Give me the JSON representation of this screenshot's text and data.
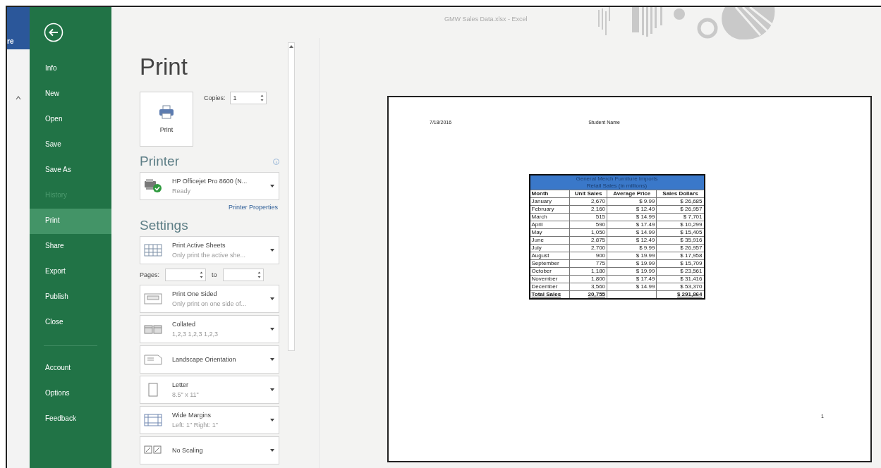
{
  "window": {
    "title": "GMW Sales Data.xlsx - Excel"
  },
  "background_ribbon": {
    "tab_label": "re"
  },
  "backstage_menu": {
    "items": [
      {
        "label": "Info",
        "selected": false,
        "disabled": false
      },
      {
        "label": "New",
        "selected": false,
        "disabled": false
      },
      {
        "label": "Open",
        "selected": false,
        "disabled": false
      },
      {
        "label": "Save",
        "selected": false,
        "disabled": false
      },
      {
        "label": "Save As",
        "selected": false,
        "disabled": false
      },
      {
        "label": "History",
        "selected": false,
        "disabled": true
      },
      {
        "label": "Print",
        "selected": true,
        "disabled": false
      },
      {
        "label": "Share",
        "selected": false,
        "disabled": false
      },
      {
        "label": "Export",
        "selected": false,
        "disabled": false
      },
      {
        "label": "Publish",
        "selected": false,
        "disabled": false
      },
      {
        "label": "Close",
        "selected": false,
        "disabled": false
      }
    ],
    "footer_items": [
      {
        "label": "Account",
        "selected": false,
        "disabled": false
      },
      {
        "label": "Options",
        "selected": false,
        "disabled": false
      },
      {
        "label": "Feedback",
        "selected": false,
        "disabled": false
      }
    ]
  },
  "print_panel": {
    "heading": "Print",
    "print_button": "Print",
    "copies_label": "Copies:",
    "copies_value": "1",
    "printer_heading": "Printer",
    "printer": {
      "name": "HP Officejet Pro 8600 (N...",
      "status": "Ready"
    },
    "printer_properties": "Printer Properties",
    "settings_heading": "Settings",
    "settings": [
      {
        "kind": "dropdown",
        "title": "Print Active Sheets",
        "subtitle": "Only print the active she..."
      },
      {
        "kind": "pages",
        "label": "Pages:",
        "to_label": "to"
      },
      {
        "kind": "dropdown",
        "title": "Print One Sided",
        "subtitle": "Only print on one side of..."
      },
      {
        "kind": "dropdown",
        "title": "Collated",
        "subtitle": "1,2,3   1,2,3   1,2,3"
      },
      {
        "kind": "dropdown",
        "title": "Landscape Orientation"
      },
      {
        "kind": "dropdown",
        "title": "Letter",
        "subtitle": "8.5\" x 11\""
      },
      {
        "kind": "dropdown",
        "title": "Wide Margins",
        "subtitle": "Left: 1\"   Right: 1\""
      },
      {
        "kind": "dropdown",
        "title": "No Scaling"
      }
    ]
  },
  "preview": {
    "header_left": "7/18/2016",
    "header_center": "Student Name",
    "page_number": "1",
    "table": {
      "title_lines": [
        "General Merch Furniture Imports",
        "Retail Sales (in millions)"
      ],
      "columns": [
        "Month",
        "Unit Sales",
        "Average Price",
        "Sales Dollars"
      ],
      "rows": [
        {
          "month": "January",
          "unit_sales": "2,670",
          "average_price": "$ 9.99",
          "sales_dollars": "$ 26,685"
        },
        {
          "month": "February",
          "unit_sales": "2,160",
          "average_price": "$ 12.49",
          "sales_dollars": "$ 26,957"
        },
        {
          "month": "March",
          "unit_sales": "515",
          "average_price": "$ 14.99",
          "sales_dollars": "$ 7,701"
        },
        {
          "month": "April",
          "unit_sales": "590",
          "average_price": "$ 17.49",
          "sales_dollars": "$ 10,299"
        },
        {
          "month": "May",
          "unit_sales": "1,050",
          "average_price": "$ 14.99",
          "sales_dollars": "$ 15,405"
        },
        {
          "month": "June",
          "unit_sales": "2,875",
          "average_price": "$ 12.49",
          "sales_dollars": "$ 35,916"
        },
        {
          "month": "July",
          "unit_sales": "2,700",
          "average_price": "$ 9.99",
          "sales_dollars": "$ 26,957"
        },
        {
          "month": "August",
          "unit_sales": "900",
          "average_price": "$ 19.99",
          "sales_dollars": "$ 17,958"
        },
        {
          "month": "September",
          "unit_sales": "775",
          "average_price": "$ 19.99",
          "sales_dollars": "$ 15,709"
        },
        {
          "month": "October",
          "unit_sales": "1,180",
          "average_price": "$ 19.99",
          "sales_dollars": "$ 23,561"
        },
        {
          "month": "November",
          "unit_sales": "1,800",
          "average_price": "$ 17.49",
          "sales_dollars": "$ 31,416"
        },
        {
          "month": "December",
          "unit_sales": "3,560",
          "average_price": "$ 14.99",
          "sales_dollars": "$ 53,370"
        }
      ],
      "total": {
        "month": "Total Sales",
        "unit_sales": "20,755",
        "sales_dollars": "$ 291,864"
      }
    }
  }
}
